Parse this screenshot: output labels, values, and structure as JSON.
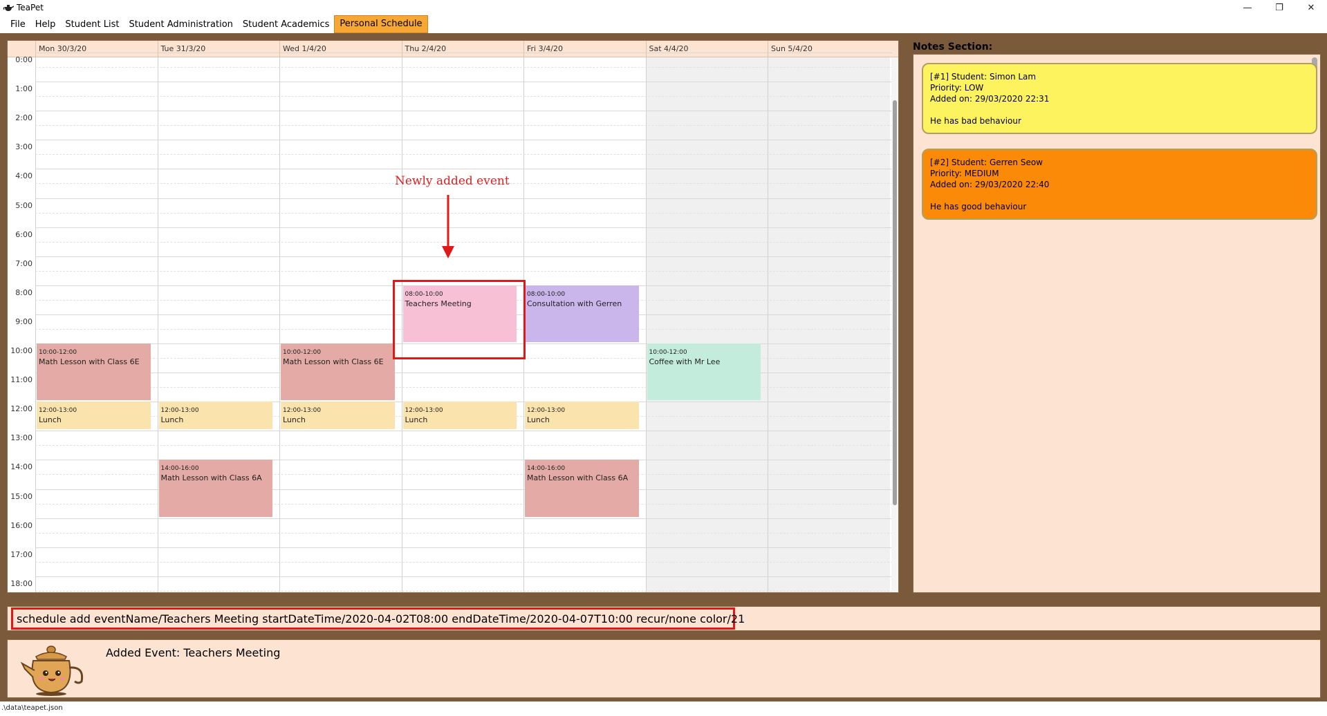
{
  "window": {
    "title": "TeaPet",
    "minimize": "—",
    "restore": "❐",
    "close": "✕"
  },
  "menu": [
    "File",
    "Help",
    "Student List",
    "Student Administration",
    "Student Academics",
    "Personal Schedule"
  ],
  "calendar": {
    "days": [
      "Mon 30/3/20",
      "Tue 31/3/20",
      "Wed 1/4/20",
      "Thu 2/4/20",
      "Fri 3/4/20",
      "Sat 4/4/20",
      "Sun 5/4/20"
    ],
    "hours": [
      "0:00",
      "1:00",
      "2:00",
      "3:00",
      "4:00",
      "5:00",
      "6:00",
      "7:00",
      "8:00",
      "9:00",
      "10:00",
      "11:00",
      "12:00",
      "13:00",
      "14:00",
      "15:00",
      "16:00",
      "17:00",
      "18:00"
    ],
    "events": [
      {
        "day": 0,
        "start": 10,
        "end": 12,
        "time": "10:00-12:00",
        "name": "Math Lesson with Class 6E",
        "color": "#e4aaa6"
      },
      {
        "day": 2,
        "start": 10,
        "end": 12,
        "time": "10:00-12:00",
        "name": "Math Lesson with Class 6E",
        "color": "#e4aaa6"
      },
      {
        "day": 0,
        "start": 12,
        "end": 13,
        "time": "12:00-13:00",
        "name": "Lunch",
        "color": "#fbe3ad"
      },
      {
        "day": 1,
        "start": 12,
        "end": 13,
        "time": "12:00-13:00",
        "name": "Lunch",
        "color": "#fbe3ad"
      },
      {
        "day": 2,
        "start": 12,
        "end": 13,
        "time": "12:00-13:00",
        "name": "Lunch",
        "color": "#fbe3ad"
      },
      {
        "day": 3,
        "start": 12,
        "end": 13,
        "time": "12:00-13:00",
        "name": "Lunch",
        "color": "#fbe3ad"
      },
      {
        "day": 4,
        "start": 12,
        "end": 13,
        "time": "12:00-13:00",
        "name": "Lunch",
        "color": "#fbe3ad"
      },
      {
        "day": 3,
        "start": 8,
        "end": 10,
        "time": "08:00-10:00",
        "name": "Teachers Meeting",
        "color": "#f8c0d4"
      },
      {
        "day": 4,
        "start": 8,
        "end": 10,
        "time": "08:00-10:00",
        "name": "Consultation with Gerren",
        "color": "#cbb6ec"
      },
      {
        "day": 5,
        "start": 10,
        "end": 12,
        "time": "10:00-12:00",
        "name": "Coffee with Mr Lee",
        "color": "#c4ecdc"
      },
      {
        "day": 1,
        "start": 14,
        "end": 16,
        "time": "14:00-16:00",
        "name": "Math Lesson with Class 6A",
        "color": "#e4aaa6"
      },
      {
        "day": 4,
        "start": 14,
        "end": 16,
        "time": "14:00-16:00",
        "name": "Math Lesson with Class 6A",
        "color": "#e4aaa6"
      }
    ]
  },
  "annotation": {
    "label": "Newly added event",
    "color": "#e01818"
  },
  "notes": {
    "title": "Notes Section:",
    "items": [
      {
        "header": "[#1] Student: Simon Lam",
        "priority": "Priority: LOW",
        "added": "Added on: 29/03/2020 22:31",
        "content": "He has bad behaviour",
        "color": "#fdf35e"
      },
      {
        "header": "[#2] Student: Gerren Seow",
        "priority": "Priority: MEDIUM",
        "added": "Added on: 29/03/2020 22:40",
        "content": "He has good behaviour",
        "color": "#fb8a08"
      }
    ]
  },
  "command": {
    "value": "schedule add eventName/Teachers Meeting startDateTime/2020-04-02T08:00 endDateTime/2020-04-07T10:00 recur/none color/21"
  },
  "result": {
    "text": "Added Event: Teachers Meeting"
  },
  "status": {
    "path": ".\\data\\teapet.json"
  }
}
